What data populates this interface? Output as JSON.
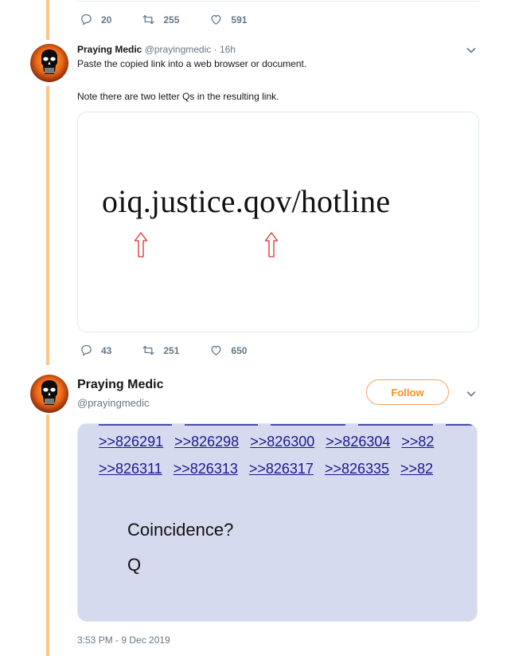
{
  "top_tweet": {
    "replies": "20",
    "retweets": "255",
    "likes": "591"
  },
  "tweet1": {
    "name": "Praying Medic",
    "handle": "@prayingmedic",
    "sep": "·",
    "time": "16h",
    "line1": "Paste the copied link into a web browser or document.",
    "line2": "Note there are two letter Qs in the resulting link.",
    "image_text": "oiq.justice.qov/hotline",
    "replies": "43",
    "retweets": "251",
    "likes": "650"
  },
  "tweet2": {
    "name": "Praying Medic",
    "handle": "@prayingmedic",
    "follow_label": "Follow",
    "links_row1": [
      ">>826291",
      ">>826298",
      ">>826300",
      ">>826304",
      ">>82"
    ],
    "links_row2": [
      ">>826311",
      ">>826313",
      ">>826317",
      ">>826335",
      ">>82"
    ],
    "q_line1": "Coincidence?",
    "q_line2": "Q",
    "timestamp": "3:53 PM - 9 Dec 2019"
  },
  "colors": {
    "thread_line": "#fbc58d",
    "accent": "#f5911e",
    "secondary_text": "#657786",
    "media_bg": "#d6daee",
    "arrow_red": "#e03030"
  },
  "icons": [
    "reply-icon",
    "retweet-icon",
    "like-icon",
    "chevron-down-icon",
    "punisher-skull-avatar"
  ]
}
